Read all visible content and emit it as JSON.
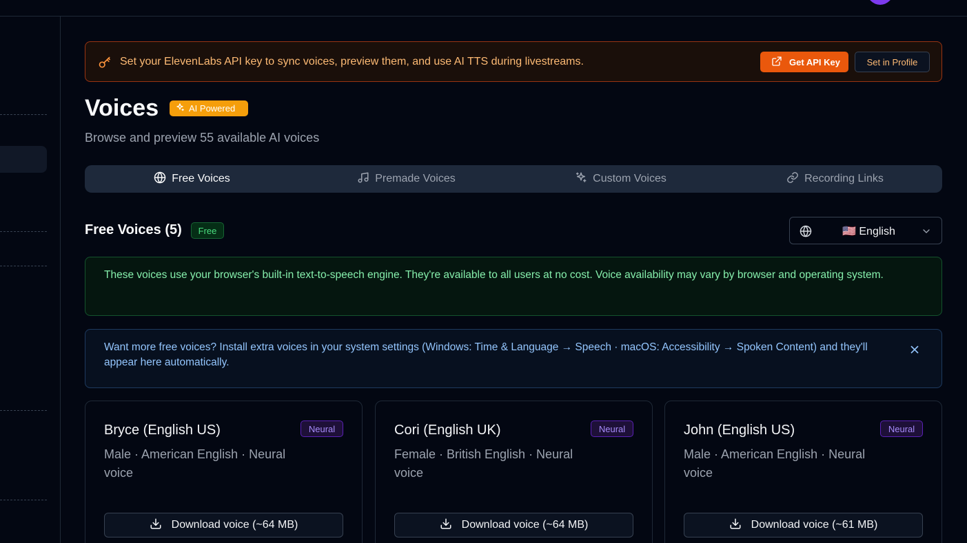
{
  "banner": {
    "text": "Set your ElevenLabs API key to sync voices, preview them, and use AI TTS during livestreams.",
    "get_key_label": "Get API Key",
    "set_profile_label": "Set in Profile"
  },
  "page": {
    "title": "Voices",
    "badge": "AI Powered",
    "subtitle": "Browse and preview 55 available AI voices"
  },
  "tabs": [
    {
      "label": "Free Voices",
      "icon": "globe-icon",
      "active": true
    },
    {
      "label": "Premade Voices",
      "icon": "music-note-icon",
      "active": false
    },
    {
      "label": "Custom Voices",
      "icon": "sparkles-icon",
      "active": false
    },
    {
      "label": "Recording Links",
      "icon": "link-icon",
      "active": false
    }
  ],
  "section": {
    "title": "Free Voices (5)",
    "badge": "Free"
  },
  "language_select": {
    "value": "🇺🇸 English"
  },
  "info_green": "These voices use your browser's built-in text-to-speech engine. They're available to all users at no cost. Voice availability may vary by browser and operating system.",
  "info_blue": "Want more free voices? Install extra voices in your system settings (Windows: Time & Language → Speech · macOS: Accessibility → Spoken Content) and they'll appear here automatically.",
  "voices": [
    {
      "name": "Bryce (English US)",
      "badge": "Neural",
      "desc": "Male · American English · Neural voice",
      "download": "Download voice (~64 MB)"
    },
    {
      "name": "Cori (English UK)",
      "badge": "Neural",
      "desc": "Female · British English · Neural voice",
      "download": "Download voice (~64 MB)"
    },
    {
      "name": "John (English US)",
      "badge": "Neural",
      "desc": "Male · American English · Neural voice",
      "download": "Download voice (~61 MB)"
    }
  ],
  "colors": {
    "background": "#030712",
    "accent_orange": "#ea580c",
    "badge_amber": "#f59e0b",
    "success_green": "#4ade80",
    "info_blue": "#93c5fd",
    "neural_purple": "#a78bfa"
  }
}
